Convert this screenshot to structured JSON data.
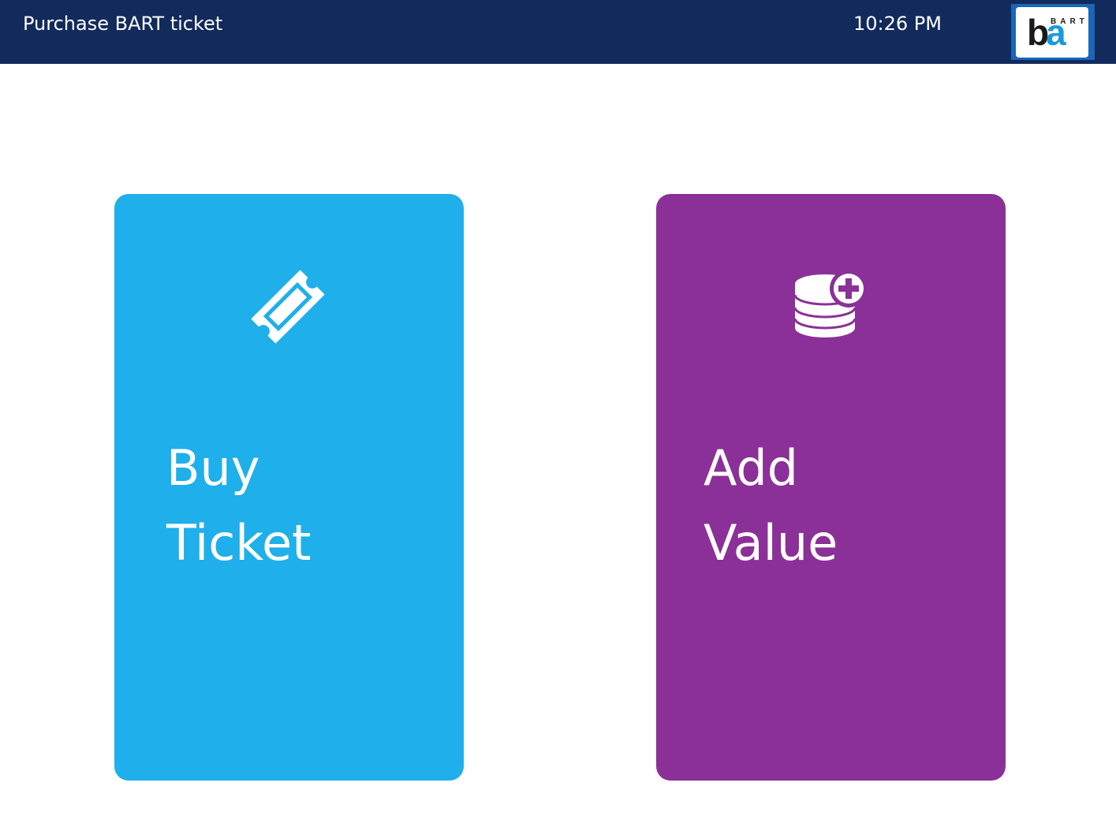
{
  "header": {
    "title": "Purchase BART ticket",
    "time": "10:26 PM",
    "logo": {
      "letters": "ba",
      "text": "BART"
    }
  },
  "options": [
    {
      "id": "buy-ticket",
      "line1": "Buy",
      "line2": "Ticket",
      "icon": "ticket-icon",
      "color": "#1fafea"
    },
    {
      "id": "add-value",
      "line1": "Add",
      "line2": "Value",
      "icon": "coins-add-icon",
      "color": "#8b3098"
    }
  ],
  "colors": {
    "header_bg": "#122a5c",
    "page_bg": "#ffffff"
  }
}
